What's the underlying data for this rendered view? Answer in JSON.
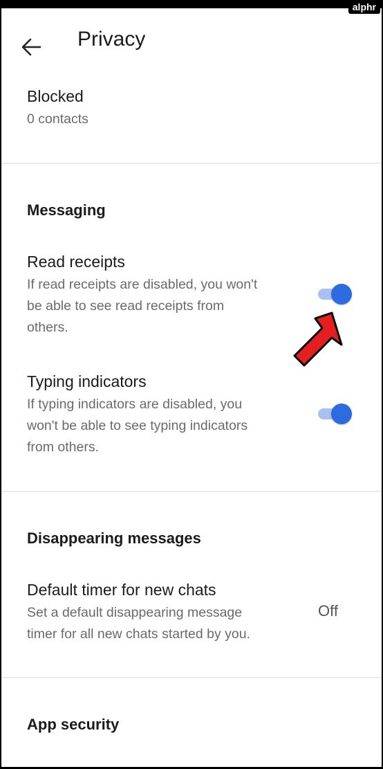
{
  "watermark": "alphr",
  "header": {
    "title": "Privacy"
  },
  "blocked": {
    "title": "Blocked",
    "subtitle": "0 contacts"
  },
  "messaging": {
    "header": "Messaging",
    "read_receipts": {
      "title": "Read receipts",
      "desc_lines": [
        "If read receipts are disabled, you won't",
        "be able to see read receipts from",
        "others."
      ],
      "enabled": true
    },
    "typing_indicators": {
      "title": "Typing indicators",
      "desc_lines": [
        "If typing indicators are disabled, you",
        "won't be able to see typing indicators",
        "from others."
      ],
      "enabled": true
    }
  },
  "disappearing": {
    "header": "Disappearing messages",
    "default_timer": {
      "title": "Default timer for new chats",
      "desc_lines": [
        "Set a default disappearing message",
        "timer for all new chats started by you."
      ],
      "value": "Off"
    }
  },
  "app_security": {
    "header": "App security"
  },
  "colors": {
    "toggle_thumb": "#2c6be0",
    "toggle_track": "#aac1f0",
    "annotation_arrow": "#e51f1f"
  }
}
